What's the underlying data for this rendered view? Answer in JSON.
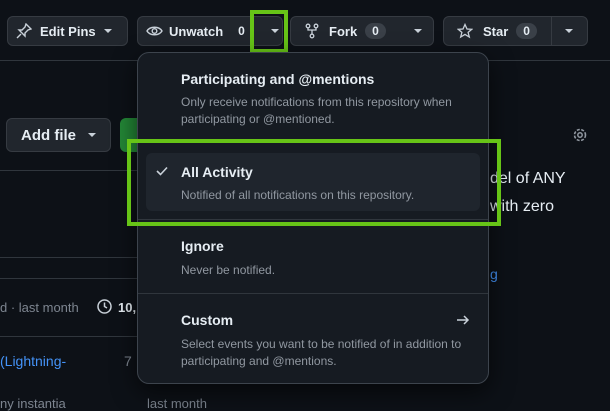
{
  "toolbar": {
    "edit_pins_label": "Edit Pins",
    "unwatch_label": "Unwatch",
    "unwatch_count": "0",
    "fork_label": "Fork",
    "fork_count": "0",
    "star_label": "Star",
    "star_count": "0"
  },
  "background": {
    "add_file_label": "Add file",
    "right_text_1": "del of ANY",
    "right_text_2": "with zero",
    "right_link": "g",
    "commit_meta": "d · last month",
    "commits_count": "10,",
    "row_link": "(Lightning-",
    "row_num": "7",
    "row_text": "ny instantia",
    "row_time": "last month"
  },
  "watch_menu": {
    "items": [
      {
        "title": "Participating and @mentions",
        "desc": "Only receive notifications from this repository when participating or @mentioned."
      },
      {
        "title": "All Activity",
        "desc": "Notified of all notifications on this repository."
      },
      {
        "title": "Ignore",
        "desc": "Never be notified."
      },
      {
        "title": "Custom",
        "desc": "Select events you want to be notified of in addition to participating and @mentions."
      }
    ]
  },
  "colors": {
    "highlight": "#67c417",
    "background": "#0d1117",
    "menu_bg": "#161b22",
    "link": "#4493f8"
  }
}
